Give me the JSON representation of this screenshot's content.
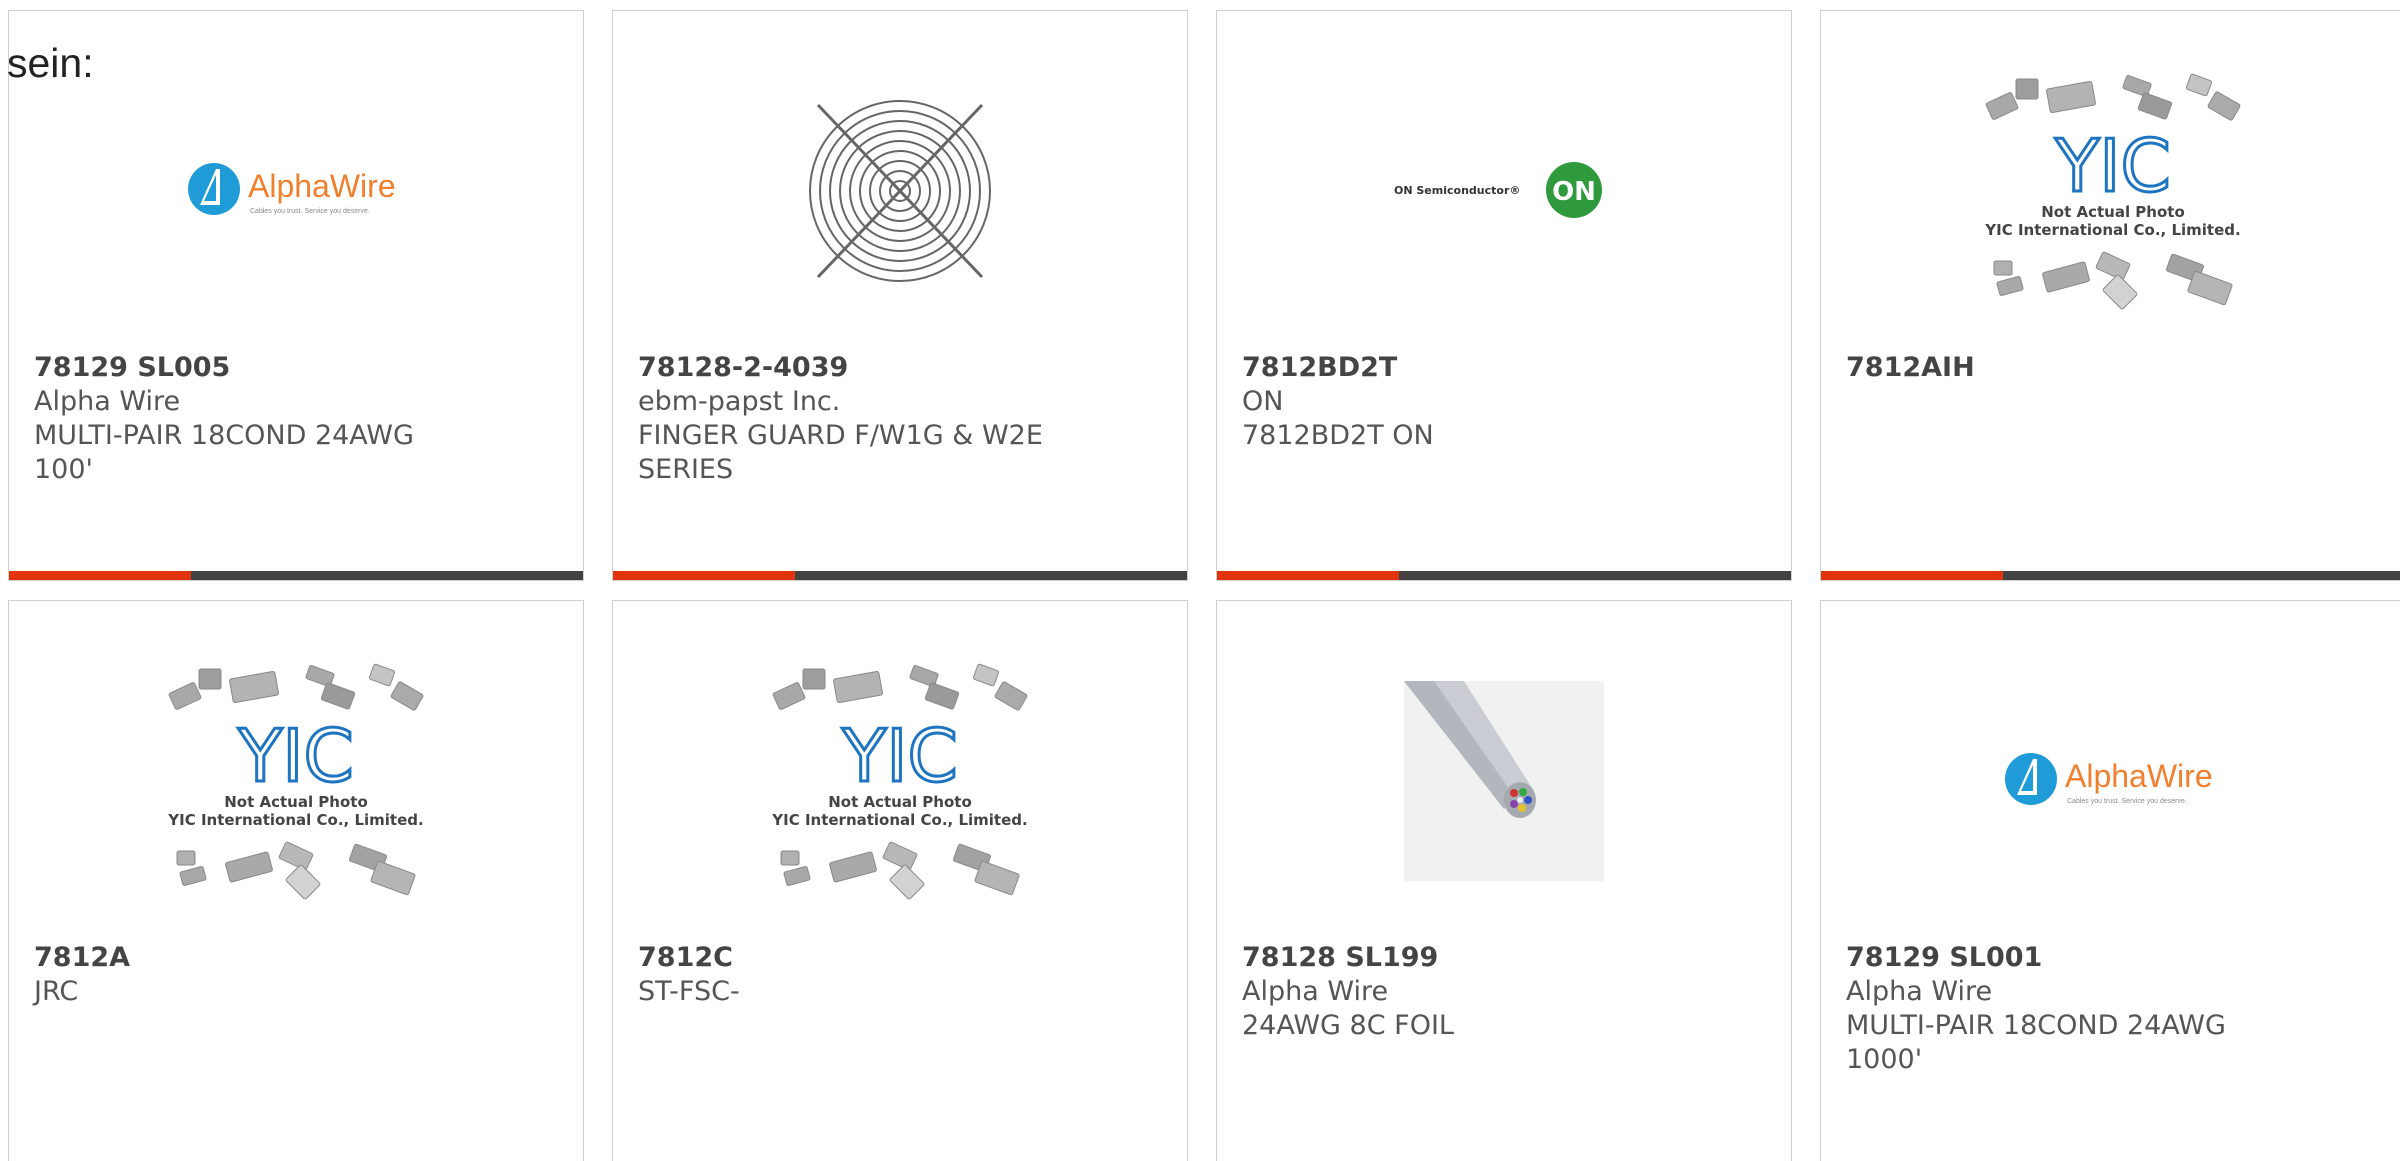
{
  "intro_text": "sein:",
  "colors": {
    "accent_bar": "#e0340e",
    "dark_bar": "#424242",
    "alphawire_blue": "#1f9bd7",
    "alphawire_orange": "#f07f2e",
    "on_green": "#2e9a3c",
    "yic_blue": "#1d74c0"
  },
  "logos": {
    "alphawire_name": "AlphaWire",
    "alphawire_tagline": "Cables you trust. Service you deserve.",
    "on_text": "ON Semiconductor®",
    "on_badge": "ON",
    "yic_line1": "Not Actual Photo",
    "yic_line2": "YIC International Co., Limited."
  },
  "products": [
    {
      "image": "alphawire-logo",
      "part_number": "78129 SL005",
      "manufacturer": "Alpha Wire",
      "description_line1": "MULTI-PAIR 18COND 24AWG",
      "description_line2": "100'"
    },
    {
      "image": "finger-guard-photo",
      "part_number": "78128-2-4039",
      "manufacturer": "ebm-papst Inc.",
      "description_line1": "FINGER GUARD F/W1G & W2E",
      "description_line2": "SERIES"
    },
    {
      "image": "on-semiconductor-logo",
      "part_number": "7812BD2T",
      "manufacturer": "ON",
      "description_line1": "7812BD2T ON",
      "description_line2": ""
    },
    {
      "image": "yic-placeholder",
      "part_number": "7812AIH",
      "manufacturer": "",
      "description_line1": "",
      "description_line2": ""
    },
    {
      "image": "yic-placeholder",
      "part_number": "7812A",
      "manufacturer": "JRC",
      "description_line1": "",
      "description_line2": ""
    },
    {
      "image": "yic-placeholder",
      "part_number": "7812C",
      "manufacturer": "ST-FSC-",
      "description_line1": "",
      "description_line2": ""
    },
    {
      "image": "cable-photo",
      "part_number": "78128 SL199",
      "manufacturer": "Alpha Wire",
      "description_line1": "24AWG 8C FOIL",
      "description_line2": ""
    },
    {
      "image": "alphawire-logo",
      "part_number": "78129 SL001",
      "manufacturer": "Alpha Wire",
      "description_line1": "MULTI-PAIR 18COND 24AWG",
      "description_line2": "1000'"
    }
  ]
}
